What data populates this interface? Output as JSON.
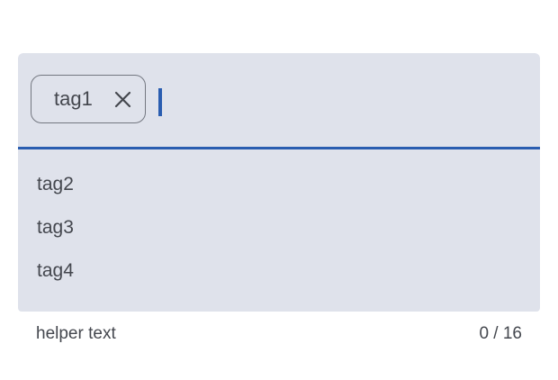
{
  "chips": [
    {
      "label": "tag1",
      "remove_icon": "close-icon"
    }
  ],
  "input": {
    "value": ""
  },
  "menu": {
    "items": [
      {
        "label": "tag2"
      },
      {
        "label": "tag3"
      },
      {
        "label": "tag4"
      }
    ]
  },
  "supporting": {
    "helper_text": "helper text",
    "counter": "0 / 16"
  },
  "colors": {
    "field_background": "#dfe2eb",
    "accent": "#2a5db0",
    "text": "#44474e",
    "outline": "#737780"
  }
}
